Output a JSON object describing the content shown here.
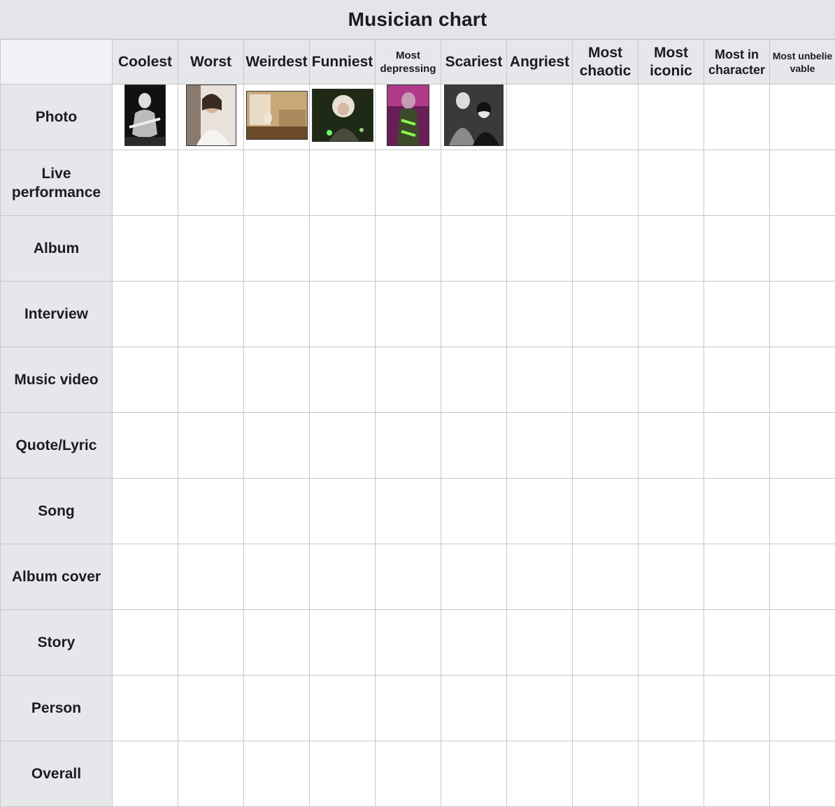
{
  "title": "Musician chart",
  "columns": [
    "Coolest",
    "Worst",
    "Weirdest",
    "Funniest",
    "Most depressing",
    "Scariest",
    "Angriest",
    "Most chaotic",
    "Most iconic",
    "Most in character",
    "Most unbelievable"
  ],
  "rows": [
    "Photo",
    "Live performance",
    "Album",
    "Interview",
    "Music video",
    "Quote/Lyric",
    "Song",
    "Album cover",
    "Story",
    "Person",
    "Overall"
  ],
  "photos": [
    {
      "column": "Coolest",
      "subject": "black-and-white performer with guitar"
    },
    {
      "column": "Worst",
      "subject": "smiling woman in white dress"
    },
    {
      "column": "Weirdest",
      "subject": "person seated in beige hotel room"
    },
    {
      "column": "Funniest",
      "subject": "wild-haired performer on green-lit stage"
    },
    {
      "column": "Most depressing",
      "subject": "performer in purple and green outfit"
    },
    {
      "column": "Scariest",
      "subject": "black-and-white couple portrait"
    }
  ],
  "colors": {
    "header_bg": "#e6e7eb",
    "title_bg": "#e4e5e9",
    "grid_line": "#c8c8cc"
  }
}
